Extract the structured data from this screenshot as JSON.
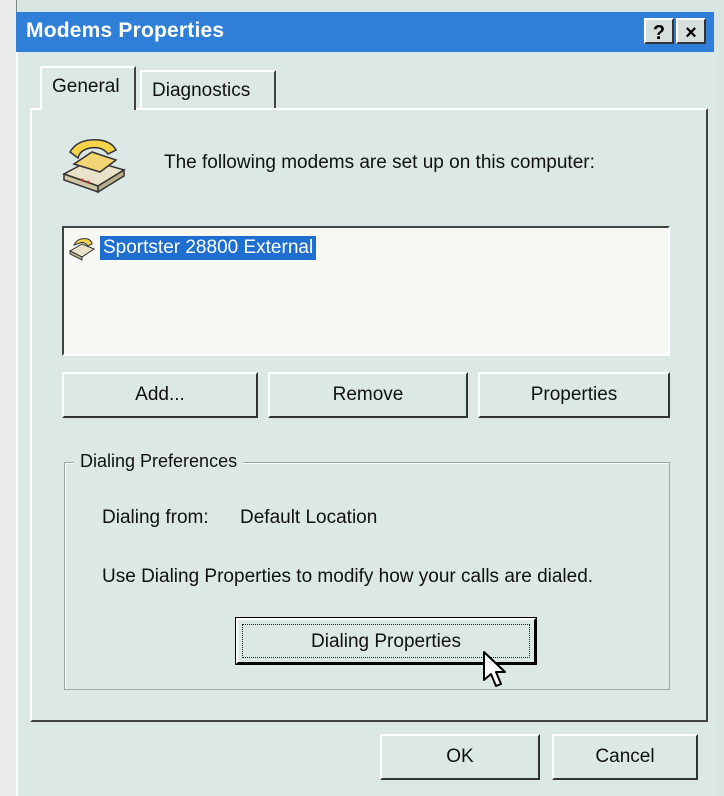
{
  "window": {
    "title": "Modems Properties",
    "help_glyph": "?",
    "close_glyph": "×"
  },
  "tabs": [
    {
      "label": "General"
    },
    {
      "label": "Diagnostics"
    }
  ],
  "intro_text": "The following modems are set up on this computer:",
  "modem_list": {
    "items": [
      {
        "label": "Sportster 28800 External",
        "selected": true
      }
    ]
  },
  "buttons": {
    "add": "Add...",
    "remove": "Remove",
    "properties": "Properties",
    "dialing_properties": "Dialing Properties",
    "ok": "OK",
    "cancel": "Cancel"
  },
  "dialing_preferences": {
    "group_title": "Dialing Preferences",
    "dialing_from_label": "Dialing from:",
    "dialing_from_value": "Default Location",
    "description": "Use Dialing Properties to modify how your calls are dialed."
  },
  "colors": {
    "titlebar": "#2f7fd9",
    "selection": "#1e6fd0",
    "face": "#dbe8e6"
  },
  "icons": {
    "header": "telephone-modem-icon",
    "list_item": "modem-icon",
    "pointer": "mouse-cursor-icon"
  }
}
